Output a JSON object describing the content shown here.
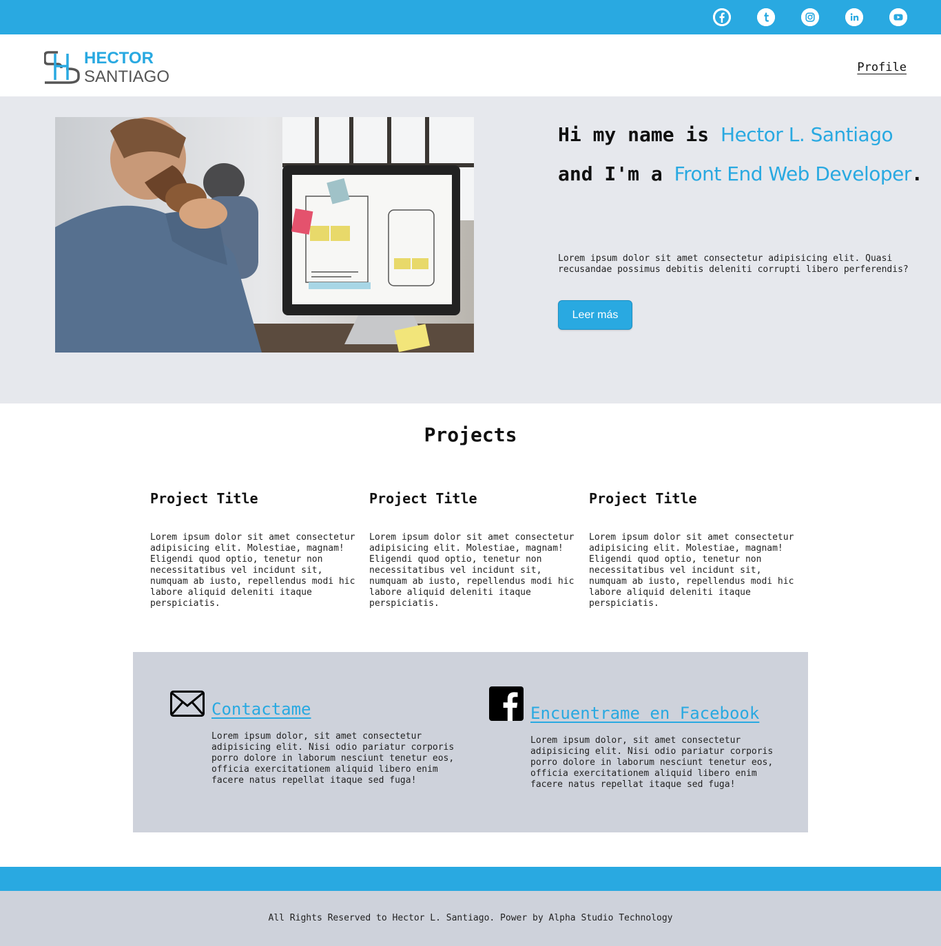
{
  "colors": {
    "accent": "#29a9e1",
    "hero_bg": "#e6e8ed",
    "panel_bg": "#ced2db"
  },
  "social": {
    "items": [
      {
        "name": "facebook",
        "icon": "facebook-icon",
        "glyph": "f"
      },
      {
        "name": "tumblr",
        "icon": "tumblr-icon",
        "glyph": "t"
      },
      {
        "name": "instagram",
        "icon": "instagram-icon",
        "glyph": ""
      },
      {
        "name": "linkedin",
        "icon": "linkedin-icon",
        "glyph": "in"
      },
      {
        "name": "youtube",
        "icon": "youtube-icon",
        "glyph": ""
      }
    ]
  },
  "header": {
    "logo_line1": "HECTOR",
    "logo_line2": "SANTIAGO",
    "nav_profile": "Profile"
  },
  "hero": {
    "heading_pre": "Hi my name is ",
    "heading_name": "Hector L. Santiago",
    "heading_mid": "and I'm a ",
    "heading_role": "Front End Web Developer",
    "heading_end": ".",
    "description": "Lorem ipsum dolor sit amet consectetur adipisicing elit. Quasi recusandae possimus debitis deleniti corrupti libero perferendis?",
    "button_label": "Leer más"
  },
  "projects": {
    "title": "Projects",
    "items": [
      {
        "title": "Project Title",
        "text": "Lorem ipsum dolor sit amet consectetur adipisicing elit. Molestiae, magnam! Eligendi quod optio, tenetur non necessitatibus vel incidunt sit, numquam ab iusto, repellendus modi hic labore aliquid deleniti itaque perspiciatis."
      },
      {
        "title": "Project Title",
        "text": "Lorem ipsum dolor sit amet consectetur adipisicing elit. Molestiae, magnam! Eligendi quod optio, tenetur non necessitatibus vel incidunt sit, numquam ab iusto, repellendus modi hic labore aliquid deleniti itaque perspiciatis."
      },
      {
        "title": "Project Title",
        "text": "Lorem ipsum dolor sit amet consectetur adipisicing elit. Molestiae, magnam! Eligendi quod optio, tenetur non necessitatibus vel incidunt sit, numquam ab iusto, repellendus modi hic labore aliquid deleniti itaque perspiciatis."
      }
    ]
  },
  "contact": {
    "email": {
      "icon": "envelope-icon",
      "link": "Contactame",
      "text": "Lorem ipsum dolor, sit amet consectetur adipisicing elit. Nisi odio pariatur corporis porro dolore in laborum nesciunt tenetur eos, officia exercitationem aliquid libero enim facere natus repellat itaque sed fuga!"
    },
    "facebook": {
      "icon": "facebook-square-icon",
      "link": "Encuentrame en Facebook",
      "text": "Lorem ipsum dolor, sit amet consectetur adipisicing elit. Nisi odio pariatur corporis porro dolore in laborum nesciunt tenetur eos, officia exercitationem aliquid libero enim facere natus repellat itaque sed fuga!"
    }
  },
  "footer": {
    "text": "All Rights Reserved to Hector L. Santiago. Power by Alpha Studio Technology"
  }
}
